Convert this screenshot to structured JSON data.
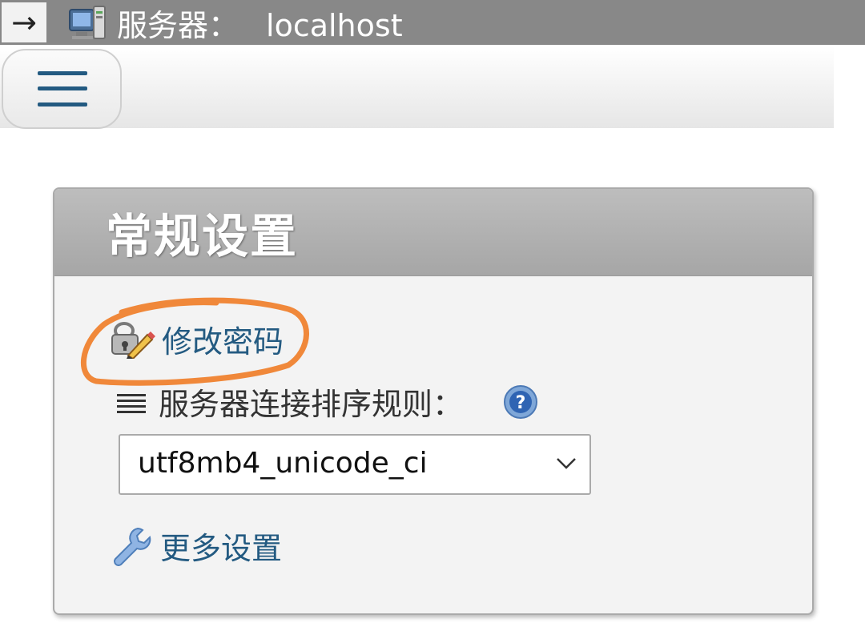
{
  "topbar": {
    "back_symbol": "→",
    "server_prefix": "服务器：",
    "server_name": "localhost"
  },
  "panel": {
    "title": "常规设置",
    "change_password": "修改密码",
    "collation_label": "服务器连接排序规则：",
    "collation_value": "utf8mb4_unicode_ci",
    "more_settings": "更多设置"
  },
  "colors": {
    "topbar": "#888888",
    "link": "#235a81",
    "panel_header": "#aaaaaa",
    "annotation": "#f0883a"
  },
  "icons": [
    "arrow-right-icon",
    "server-icon",
    "hamburger-menu-icon",
    "password-lock-icon",
    "list-icon",
    "help-icon",
    "chevron-down-icon",
    "wrench-icon"
  ]
}
